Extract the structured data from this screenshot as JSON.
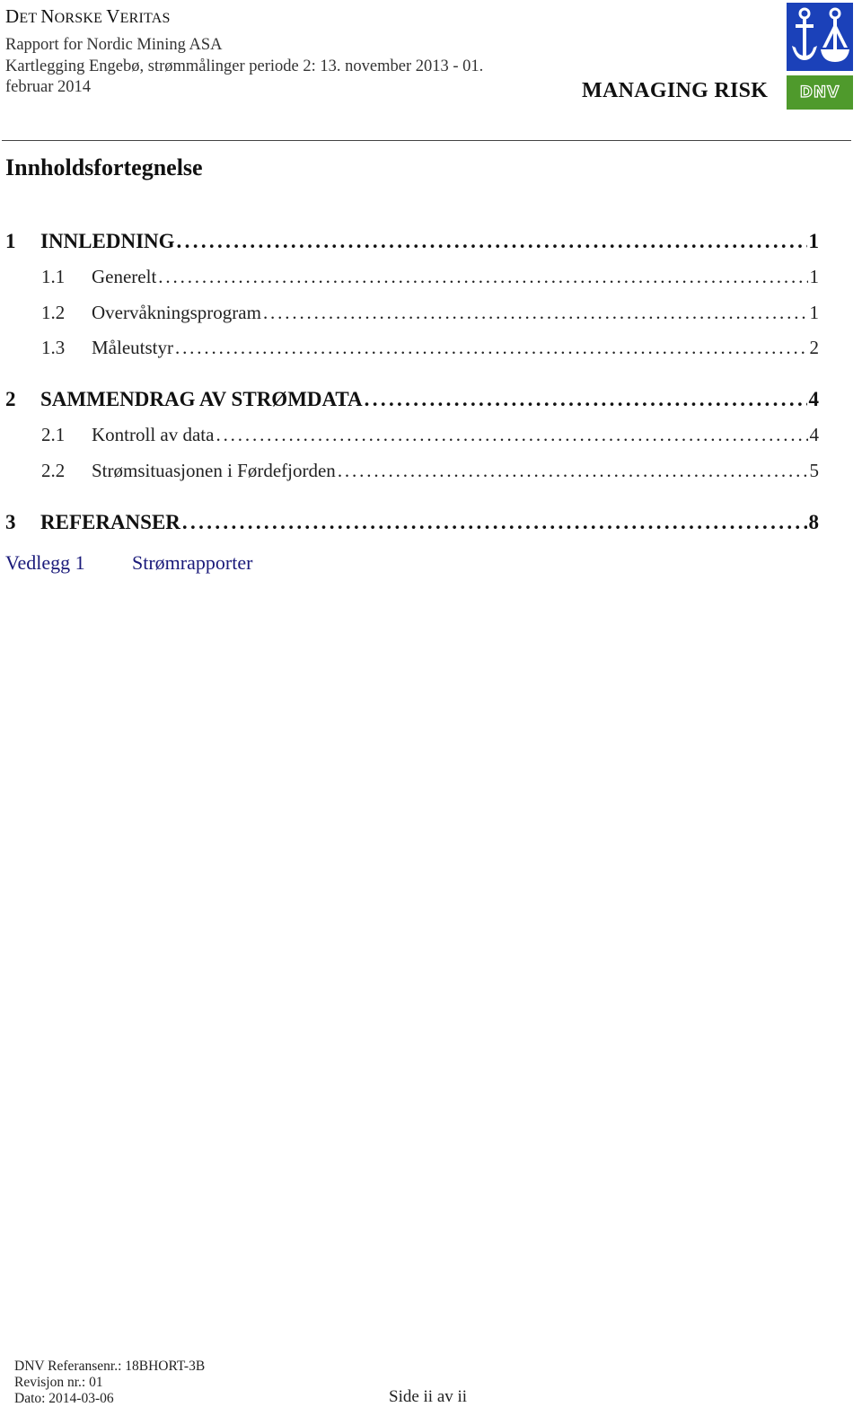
{
  "header": {
    "company_name_parts": [
      {
        "big": "D",
        "small": "ET "
      },
      {
        "big": "N",
        "small": "ORSKE "
      },
      {
        "big": "V",
        "small": "ERITAS"
      }
    ],
    "report_for": "Rapport for Nordic Mining ASA",
    "report_title_line1": "Kartlegging Engebø, strømmålinger periode 2: 13. november 2013 - 01.",
    "report_title_line2": "februar 2014",
    "slogan": "MANAGING RISK",
    "logo_text": "DNV",
    "logo_colors": {
      "top": "#1b41b9",
      "bottom": "#4f9a2c"
    }
  },
  "toc": {
    "title": "Innholdsfortegnelse",
    "entries": [
      {
        "level": 1,
        "number": "1",
        "label": "INNLEDNING",
        "page": "1"
      },
      {
        "level": 2,
        "number": "1.1",
        "label": "Generelt",
        "page": "1"
      },
      {
        "level": 2,
        "number": "1.2",
        "label": "Overvåkningsprogram",
        "page": "1"
      },
      {
        "level": 2,
        "number": "1.3",
        "label": "Måleutstyr",
        "page": "2"
      },
      {
        "level": 1,
        "number": "2",
        "label": "SAMMENDRAG AV STRØMDATA",
        "page": "4"
      },
      {
        "level": 2,
        "number": "2.1",
        "label": "Kontroll av data",
        "page": "4"
      },
      {
        "level": 2,
        "number": "2.2",
        "label": "Strømsituasjonen i Førdefjorden",
        "page": "5"
      },
      {
        "level": 1,
        "number": "3",
        "label": "REFERANSER",
        "page": "8"
      }
    ],
    "appendix": {
      "label": "Vedlegg 1",
      "title": "Strømrapporter",
      "color": "#1a1a7a"
    }
  },
  "footer": {
    "reference": "DNV Referansenr.: 18BHORT-3B",
    "revision": "Revisjon nr.: 01",
    "date": "Dato: 2014-03-06",
    "page_indicator": "Side ii av ii"
  }
}
